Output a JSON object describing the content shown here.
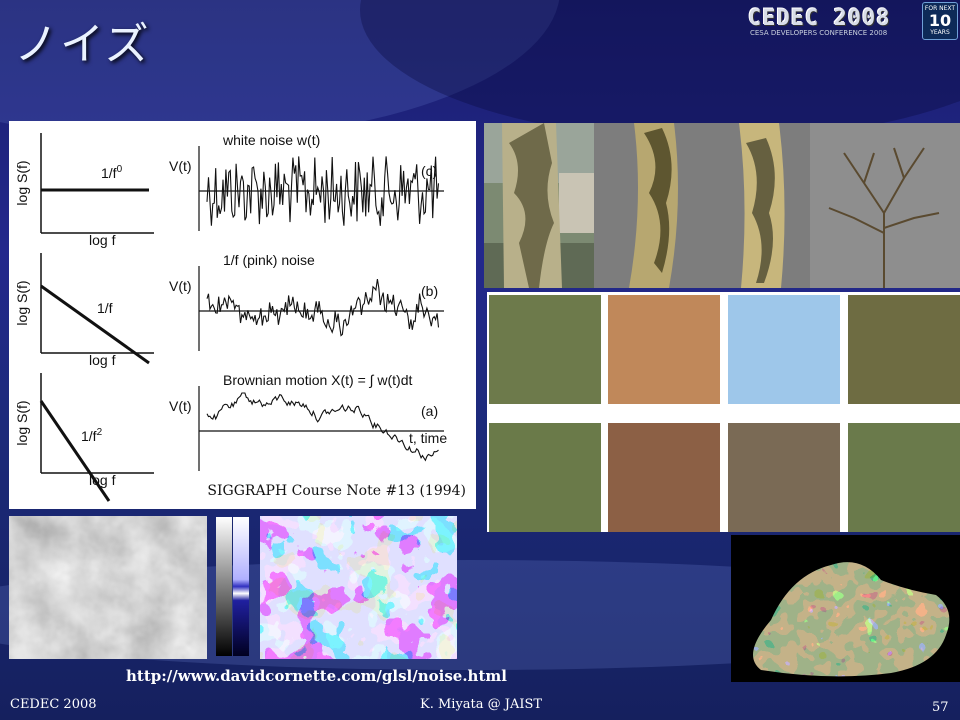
{
  "slide": {
    "title": "ノイズ",
    "logo_text": "CEDEC 2008",
    "logo_subtitle": "CESA DEVELOPERS CONFERENCE 2008",
    "badge": {
      "line1": "FOR NEXT",
      "line2": "10",
      "line3": "YEARS"
    },
    "figure_caption": "SIGGRAPH Course Note #13 (1994)",
    "url": "http://www.davidcornette.com/glsl/noise.html",
    "footer_left": "CEDEC 2008",
    "footer_center": "K. Miyata @ JAIST",
    "page_number": "57"
  },
  "spectra": [
    {
      "ylabel": "log S(f)",
      "xlabel": "log f",
      "label": "1/f",
      "label_sup": "0",
      "slope": 0
    },
    {
      "ylabel": "log S(f)",
      "xlabel": "log f",
      "label": "1/f",
      "label_sup": "",
      "slope": 1
    },
    {
      "ylabel": "log S(f)",
      "xlabel": "log f",
      "label": "1/f",
      "label_sup": "2",
      "slope": 2
    }
  ],
  "signals": [
    {
      "ylabel": "V(t)",
      "title": "white noise  w(t)",
      "tag": "(c)",
      "kind": "white"
    },
    {
      "ylabel": "V(t)",
      "title": "1/f (pink) noise",
      "tag": "(b)",
      "kind": "pink"
    },
    {
      "ylabel": "V(t)",
      "title": "Brownian motion  X(t) = ∫ w(t)dt",
      "tag": "(a)",
      "kind": "brown",
      "xlabel": "t, time"
    }
  ],
  "colors": {
    "background": "#1f2680",
    "trace": "#111111",
    "swatches": [
      "#3f4a30",
      "#8a5a35",
      "#4f87c0",
      "#4e5236",
      "#3c4a2e",
      "#5a3a28",
      "#4a3a2c",
      "#3b4a30"
    ],
    "swatch_spots": [
      "#6d7a4c",
      "#c0885a",
      "#9ec7ea",
      "#6e6c42",
      "#6b7a48",
      "#8c6044",
      "#7a6a55",
      "#6a7a4c"
    ]
  }
}
